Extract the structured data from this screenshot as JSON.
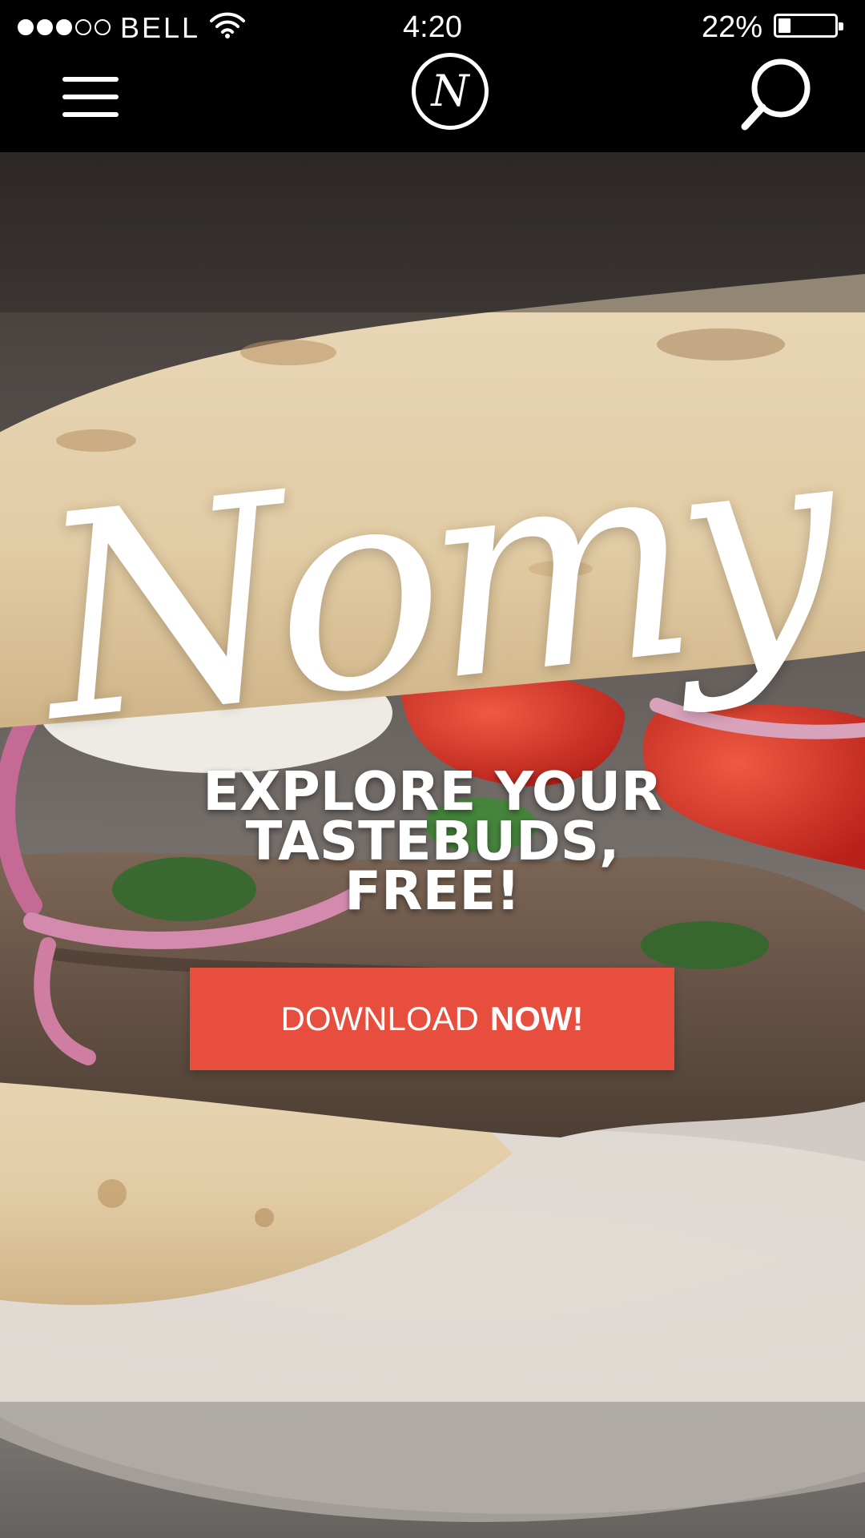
{
  "status_bar": {
    "signal_bars_filled": 3,
    "signal_bars_total": 5,
    "carrier": "BELL",
    "time": "4:20",
    "battery_percent_label": "22%",
    "battery_level": 0.22
  },
  "nav": {
    "menu_icon": "hamburger-icon",
    "logo_letter": "N",
    "search_icon": "search-icon"
  },
  "hero": {
    "brand_name": "Nomy",
    "tagline_lines": [
      "EXPLORE YOUR",
      "TASTEBUDS,",
      "FREE!"
    ],
    "cta": {
      "label_regular": "DOWNLOAD",
      "label_bold": "NOW!"
    }
  },
  "colors": {
    "bar_background": "#000000",
    "accent": "#e84e3e",
    "text": "#ffffff"
  }
}
